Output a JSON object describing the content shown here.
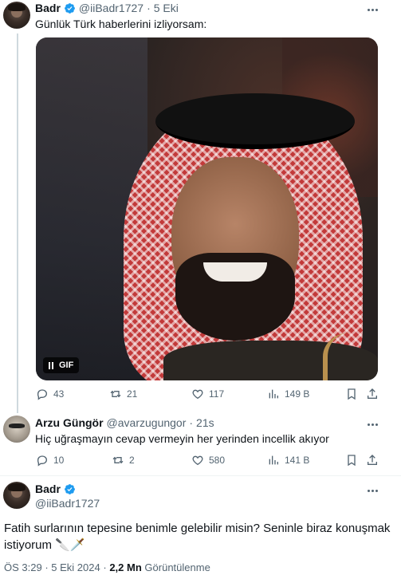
{
  "thread": {
    "tweet1": {
      "name": "Badr",
      "handle": "@iiBadr1727",
      "separator": "·",
      "time": "5 Eki",
      "text": "Günlük Türk haberlerini izliyorsam:",
      "media_badge": "GIF",
      "stats": {
        "replies": "43",
        "reposts": "21",
        "likes": "117",
        "views": "149 B"
      }
    },
    "tweet2": {
      "name": "Arzu Güngör",
      "handle": "@avarzugungor",
      "separator": "·",
      "time": "21s",
      "text": "Hiç uğraşmayın cevap vermeyin her yerinden incellik akıyor",
      "stats": {
        "replies": "10",
        "reposts": "2",
        "likes": "580",
        "views": "141 B"
      }
    }
  },
  "main_tweet": {
    "name": "Badr",
    "handle": "@iiBadr1727",
    "text": "Fatih surlarının tepesine benimle gelebilir misin? Seninle biraz konuşmak istiyorum 🔪🗡️",
    "time": "ÖS 3:29",
    "separator": "·",
    "date": "5 Eki 2024",
    "views_count": "2,2 Mn",
    "views_label": "Görüntülenme"
  },
  "colors": {
    "verified": "#1d9bf0",
    "muted": "#536471",
    "text": "#0f1419",
    "divider": "#eff3f4"
  }
}
